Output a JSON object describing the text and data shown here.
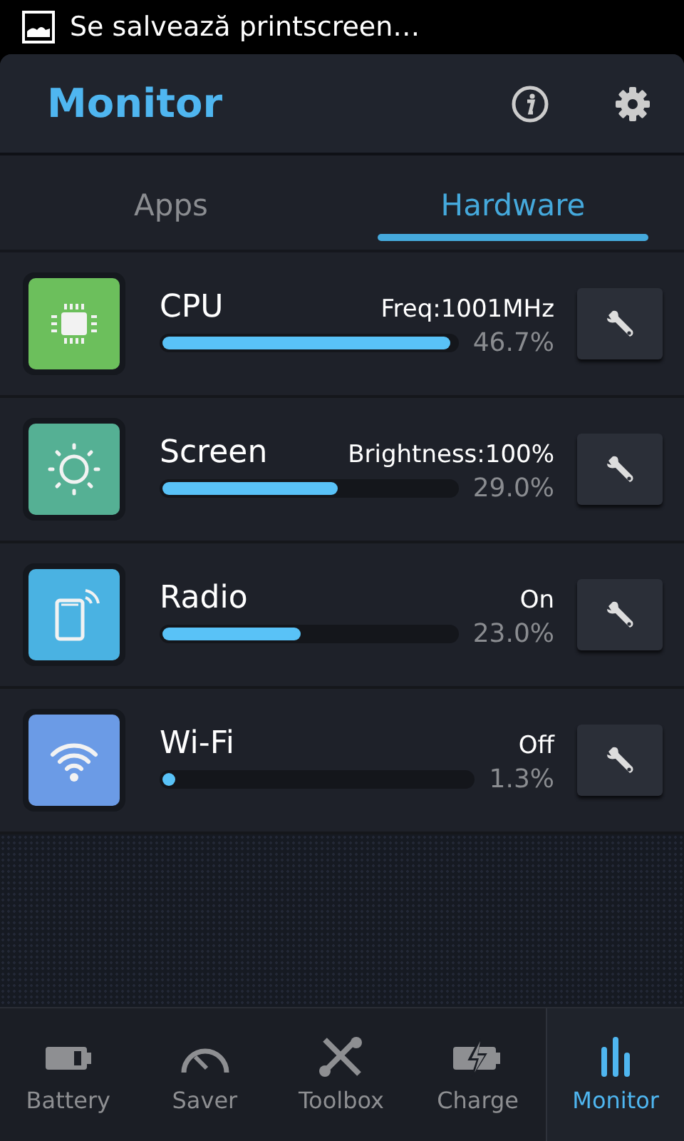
{
  "status_bar": {
    "notification": "Se salvează printscreen…"
  },
  "header": {
    "title": "Monitor"
  },
  "tabs": [
    {
      "label": "Apps",
      "selected": false
    },
    {
      "label": "Hardware",
      "selected": true
    }
  ],
  "items": [
    {
      "kind": "cpu",
      "color": "#6cbf5c",
      "name": "CPU",
      "info": "Freq:1001MHz",
      "level": 0.98,
      "reading": "46.7%"
    },
    {
      "kind": "screen",
      "color": "#55b094",
      "name": "Screen",
      "info": "Brightness:100%",
      "level": 0.6,
      "reading": "29.0%"
    },
    {
      "kind": "radio",
      "color": "#4ab2e2",
      "name": "Radio",
      "info": "On",
      "level": 0.47,
      "reading": "23.0%"
    },
    {
      "kind": "wifi",
      "color": "#6b9be6",
      "name": "Wi-Fi",
      "info": "Off",
      "level": 0.04,
      "reading": "1.3%"
    }
  ],
  "nav": [
    {
      "kind": "battery",
      "label": "Battery",
      "selected": false
    },
    {
      "kind": "saver",
      "label": "Saver",
      "selected": false
    },
    {
      "kind": "toolbox",
      "label": "Toolbox",
      "selected": false
    },
    {
      "kind": "charge",
      "label": "Charge",
      "selected": false
    },
    {
      "kind": "monitor",
      "label": "Monitor",
      "selected": true
    }
  ]
}
